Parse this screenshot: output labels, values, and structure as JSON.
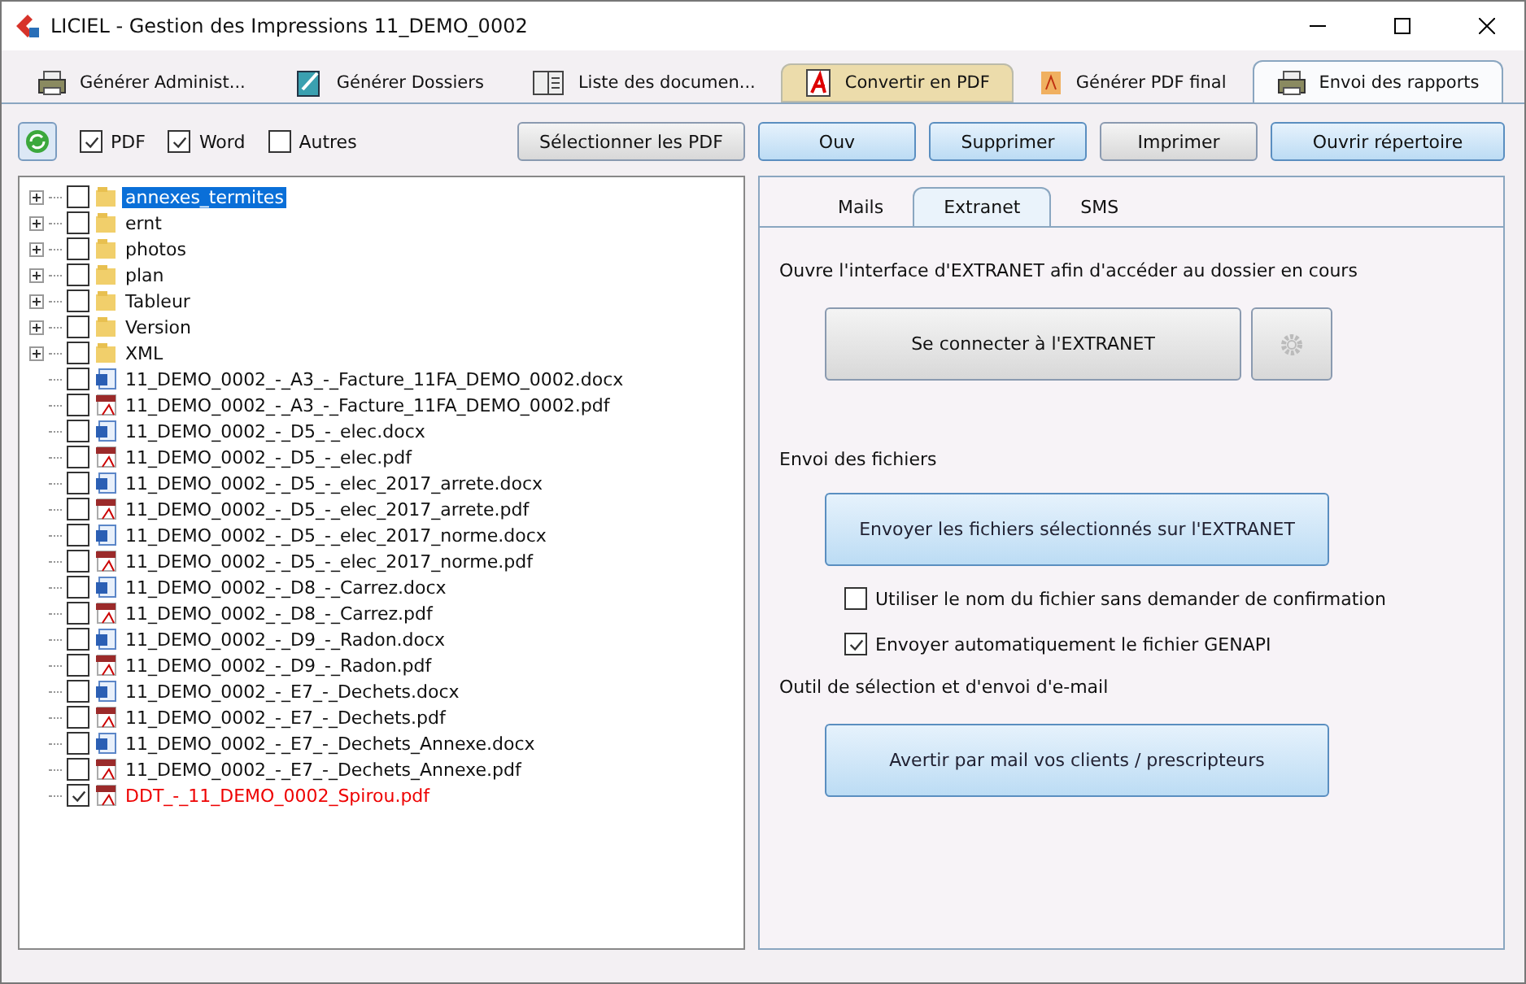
{
  "window": {
    "title": "LICIEL - Gestion des Impressions  11_DEMO_0002"
  },
  "tabs": [
    {
      "label": "Générer Administ...",
      "selected": false,
      "hot": false
    },
    {
      "label": "Générer Dossiers",
      "selected": false,
      "hot": false
    },
    {
      "label": "Liste des documen...",
      "selected": false,
      "hot": false
    },
    {
      "label": "Convertir en PDF",
      "selected": false,
      "hot": true
    },
    {
      "label": "Générer PDF final",
      "selected": false,
      "hot": false
    },
    {
      "label": "Envoi des rapports",
      "selected": true,
      "hot": false
    }
  ],
  "filters": [
    {
      "label": "PDF",
      "checked": true
    },
    {
      "label": "Word",
      "checked": true
    },
    {
      "label": "Autres",
      "checked": false
    }
  ],
  "select_button": "Sélectionner les PDF",
  "actions": [
    {
      "label": "Ouv",
      "highlighted": true
    },
    {
      "label": "Supprimer",
      "highlighted": true
    },
    {
      "label": "Imprimer",
      "highlighted": false
    },
    {
      "label": "Ouvrir répertoire",
      "highlighted": true
    }
  ],
  "tree": [
    {
      "kind": "folder",
      "name": "annexes_termites",
      "checked": false,
      "selected": true,
      "marked": false
    },
    {
      "kind": "folder",
      "name": "ernt",
      "checked": false,
      "selected": false,
      "marked": false
    },
    {
      "kind": "folder",
      "name": "photos",
      "checked": false,
      "selected": false,
      "marked": false
    },
    {
      "kind": "folder",
      "name": "plan",
      "checked": false,
      "selected": false,
      "marked": false
    },
    {
      "kind": "folder",
      "name": "Tableur",
      "checked": false,
      "selected": false,
      "marked": false
    },
    {
      "kind": "folder",
      "name": "Version",
      "checked": false,
      "selected": false,
      "marked": false
    },
    {
      "kind": "folder",
      "name": "XML",
      "checked": false,
      "selected": false,
      "marked": false
    },
    {
      "kind": "docx",
      "name": "11_DEMO_0002_-_A3_-_Facture_11FA_DEMO_0002.docx",
      "checked": false,
      "selected": false,
      "marked": false
    },
    {
      "kind": "pdf",
      "name": "11_DEMO_0002_-_A3_-_Facture_11FA_DEMO_0002.pdf",
      "checked": false,
      "selected": false,
      "marked": false
    },
    {
      "kind": "docx",
      "name": "11_DEMO_0002_-_D5_-_elec.docx",
      "checked": false,
      "selected": false,
      "marked": false
    },
    {
      "kind": "pdf",
      "name": "11_DEMO_0002_-_D5_-_elec.pdf",
      "checked": false,
      "selected": false,
      "marked": false
    },
    {
      "kind": "docx",
      "name": "11_DEMO_0002_-_D5_-_elec_2017_arrete.docx",
      "checked": false,
      "selected": false,
      "marked": false
    },
    {
      "kind": "pdf",
      "name": "11_DEMO_0002_-_D5_-_elec_2017_arrete.pdf",
      "checked": false,
      "selected": false,
      "marked": false
    },
    {
      "kind": "docx",
      "name": "11_DEMO_0002_-_D5_-_elec_2017_norme.docx",
      "checked": false,
      "selected": false,
      "marked": false
    },
    {
      "kind": "pdf",
      "name": "11_DEMO_0002_-_D5_-_elec_2017_norme.pdf",
      "checked": false,
      "selected": false,
      "marked": false
    },
    {
      "kind": "docx",
      "name": "11_DEMO_0002_-_D8_-_Carrez.docx",
      "checked": false,
      "selected": false,
      "marked": false
    },
    {
      "kind": "pdf",
      "name": "11_DEMO_0002_-_D8_-_Carrez.pdf",
      "checked": false,
      "selected": false,
      "marked": false
    },
    {
      "kind": "docx",
      "name": "11_DEMO_0002_-_D9_-_Radon.docx",
      "checked": false,
      "selected": false,
      "marked": false
    },
    {
      "kind": "pdf",
      "name": "11_DEMO_0002_-_D9_-_Radon.pdf",
      "checked": false,
      "selected": false,
      "marked": false
    },
    {
      "kind": "docx",
      "name": "11_DEMO_0002_-_E7_-_Dechets.docx",
      "checked": false,
      "selected": false,
      "marked": false
    },
    {
      "kind": "pdf",
      "name": "11_DEMO_0002_-_E7_-_Dechets.pdf",
      "checked": false,
      "selected": false,
      "marked": false
    },
    {
      "kind": "docx",
      "name": "11_DEMO_0002_-_E7_-_Dechets_Annexe.docx",
      "checked": false,
      "selected": false,
      "marked": false
    },
    {
      "kind": "pdf",
      "name": "11_DEMO_0002_-_E7_-_Dechets_Annexe.pdf",
      "checked": false,
      "selected": false,
      "marked": false
    },
    {
      "kind": "pdf",
      "name": "DDT_-_11_DEMO_0002_Spirou.pdf",
      "checked": true,
      "selected": false,
      "marked": true
    }
  ],
  "subtabs": [
    {
      "label": "Mails",
      "selected": false
    },
    {
      "label": "Extranet",
      "selected": true
    },
    {
      "label": "SMS",
      "selected": false
    }
  ],
  "extranet": {
    "intro": "Ouvre l'interface d'EXTRANET afin d'accéder au dossier en cours",
    "connect_button": "Se connecter à l'EXTRANET",
    "files_heading": "Envoi des fichiers",
    "send_button": "Envoyer les fichiers sélectionnés sur l'EXTRANET",
    "options": [
      {
        "label": "Utiliser le nom du fichier sans demander de confirmation",
        "checked": false
      },
      {
        "label": "Envoyer automatiquement le fichier GENAPI",
        "checked": true
      }
    ],
    "mail_heading": "Outil de sélection et d'envoi d'e-mail",
    "mail_button": "Avertir par mail vos clients / prescripteurs"
  }
}
